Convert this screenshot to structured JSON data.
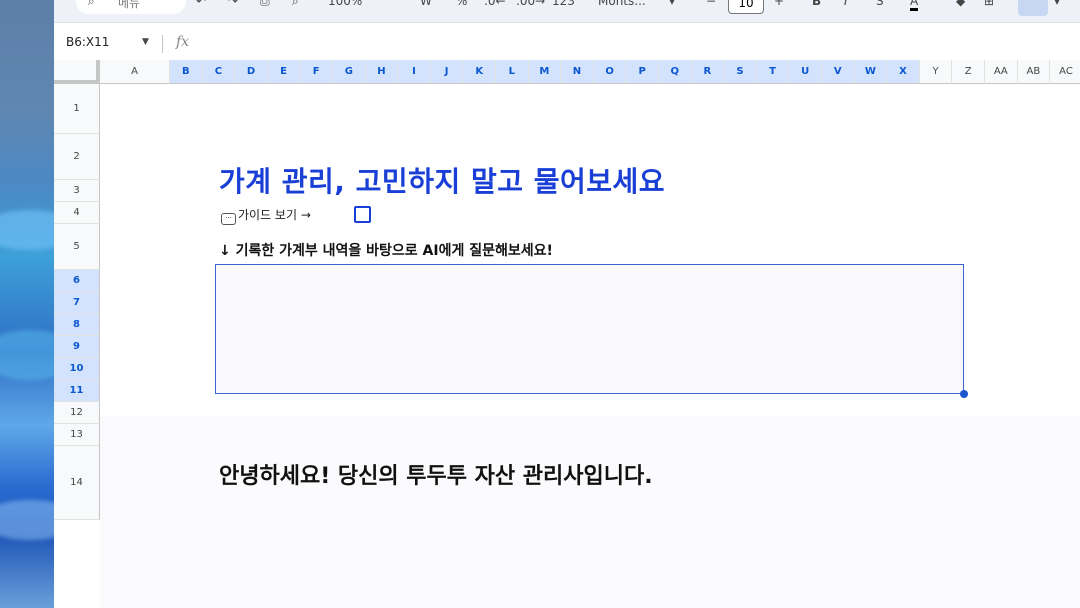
{
  "toolbar": {
    "search_text": "메뉴",
    "zoom": "100%",
    "format_percent": "%",
    "format_123": "123",
    "font_name": "Monts...",
    "font_size": "10",
    "minus": "−",
    "plus": "+",
    "bold": "B"
  },
  "formula_bar": {
    "name_box": "B6:X11",
    "fx_label": "fx"
  },
  "columns": [
    "A",
    "B",
    "C",
    "D",
    "E",
    "F",
    "G",
    "H",
    "I",
    "J",
    "K",
    "L",
    "M",
    "N",
    "O",
    "P",
    "Q",
    "R",
    "S",
    "T",
    "U",
    "V",
    "W",
    "X",
    "Y",
    "Z",
    "AA",
    "AB",
    "AC"
  ],
  "selected_columns": "B:X",
  "rows": [
    "1",
    "2",
    "3",
    "4",
    "5",
    "6",
    "7",
    "8",
    "9",
    "10",
    "11",
    "12",
    "13",
    "14"
  ],
  "selected_rows": "6:11",
  "content": {
    "title": "가계 관리, 고민하지 말고 물어보세요",
    "guide_link": "가이드 보기 →",
    "prompt_label": "↓ 기록한 가계부 내역을 바탕으로 AI에게 질문해보세요!",
    "greeting": "안녕하세요! 당신의 투두투 자산 관리사입니다."
  },
  "colors": {
    "title": "#1a3fd6",
    "selection_header": "#d3e3fd",
    "selection_border": "#3b63d6"
  }
}
